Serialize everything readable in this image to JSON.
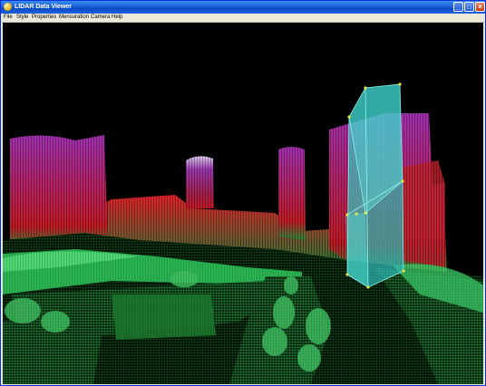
{
  "window": {
    "title": "LIDAR Data Viewer",
    "app_icon": "globe-icon",
    "controls": {
      "minimize": "_",
      "maximize": "□",
      "close": "×"
    }
  },
  "menu": {
    "items": [
      {
        "label": "File"
      },
      {
        "label": "Style"
      },
      {
        "label": "Properties"
      },
      {
        "label": "Mensuration"
      },
      {
        "label": "Camera"
      },
      {
        "label": "Help"
      }
    ]
  },
  "viewport": {
    "background": "#000000",
    "elevation_colors": {
      "low": "#1f8a3a",
      "mid": "#d11f2a",
      "high": "#8a2fa0",
      "peak": "#d9c8f0"
    },
    "measurement_color": "#35d6d0",
    "vertex_color": "#e8e64a"
  }
}
